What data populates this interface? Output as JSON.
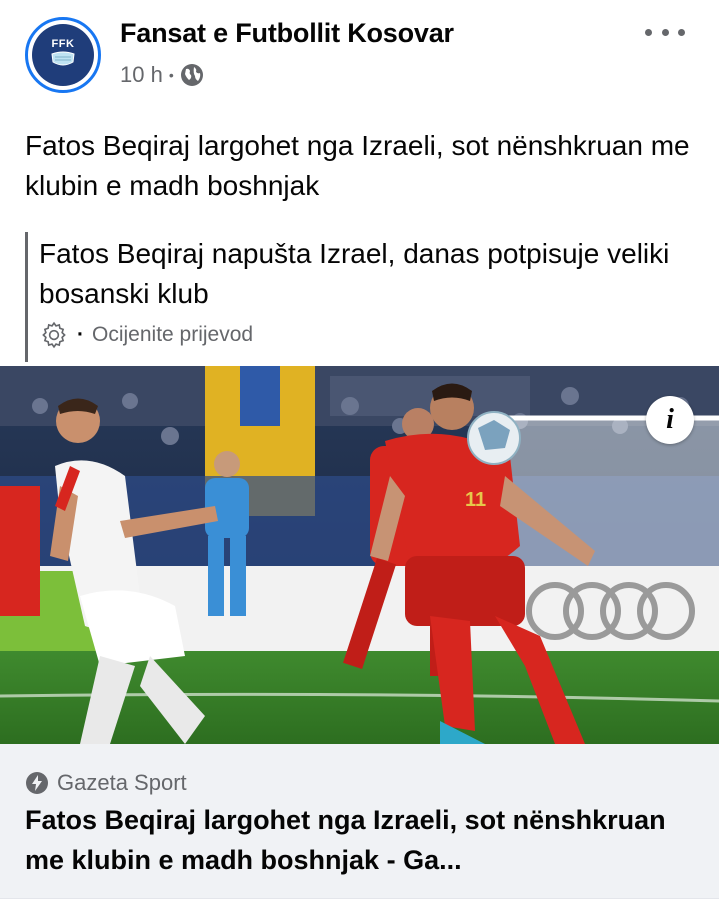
{
  "post": {
    "page_name": "Fansat e Futbollit Kosovar",
    "avatar_text": "FFK",
    "time": "10 h",
    "separator": "•",
    "audience_icon": "globe-icon",
    "more_icon": "more-horizontal-icon",
    "text": "Fatos Beqiraj largohet nga Izraeli, sot nënshkruan me klubin e madh boshnjak",
    "translation": {
      "text": "Fatos Beqiraj napušta Izrael, danas potpisuje veliki bosanski klub",
      "rate_label": "Ocijenite prijevod",
      "rate_separator": "·",
      "settings_icon": "gear-icon"
    }
  },
  "image": {
    "info_label": "i",
    "home_kit_color": "#d7261f",
    "away_kit_color": "#f4f4f4"
  },
  "link": {
    "source": "Gazeta Sport",
    "source_icon": "lightning-bolt-icon",
    "title": "Fatos Beqiraj largohet nga Izraeli, sot nënshkruan me klubin e madh boshnjak - Ga..."
  },
  "colors": {
    "accent": "#1877f2",
    "text_primary": "#050505",
    "text_secondary": "#65676b",
    "card_background": "#f0f2f5"
  }
}
